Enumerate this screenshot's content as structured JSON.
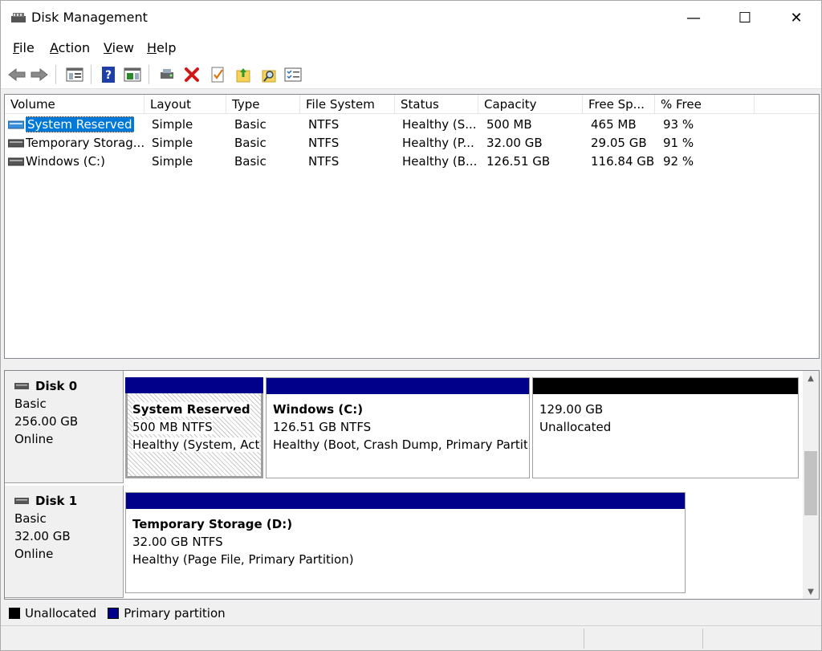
{
  "window": {
    "title": "Disk Management",
    "minimize_glyph": "—",
    "maximize_glyph": "☐",
    "close_glyph": "✕"
  },
  "menu": [
    {
      "label": "File",
      "mnemonic": "F"
    },
    {
      "label": "Action",
      "mnemonic": "A"
    },
    {
      "label": "View",
      "mnemonic": "V"
    },
    {
      "label": "Help",
      "mnemonic": "H"
    }
  ],
  "toolbar": {
    "icons": [
      "back-arrow-icon",
      "forward-arrow-icon",
      "show-hide-console-tree-icon",
      "help-icon",
      "show-hide-action-pane-icon",
      "connect-virtual-disk-icon",
      "delete-icon",
      "check-properties-icon",
      "open-folder-icon",
      "explore-icon",
      "list-view-icon"
    ]
  },
  "volume_list": {
    "columns": [
      "Volume",
      "Layout",
      "Type",
      "File System",
      "Status",
      "Capacity",
      "Free Sp...",
      "% Free"
    ],
    "rows": [
      {
        "volume": "System Reserved",
        "layout": "Simple",
        "type": "Basic",
        "fs": "NTFS",
        "status": "Healthy (S...",
        "capacity": "500 MB",
        "free": "465 MB",
        "pct": "93 %",
        "selected": true
      },
      {
        "volume": "Temporary Storag...",
        "layout": "Simple",
        "type": "Basic",
        "fs": "NTFS",
        "status": "Healthy (P...",
        "capacity": "32.00 GB",
        "free": "29.05 GB",
        "pct": "91 %",
        "selected": false
      },
      {
        "volume": "Windows (C:)",
        "layout": "Simple",
        "type": "Basic",
        "fs": "NTFS",
        "status": "Healthy (B...",
        "capacity": "126.51 GB",
        "free": "116.84 GB",
        "pct": "92 %",
        "selected": false
      }
    ]
  },
  "disks": [
    {
      "name": "Disk 0",
      "type": "Basic",
      "size": "256.00 GB",
      "state": "Online",
      "partitions": [
        {
          "title": "System Reserved",
          "line2": "500 MB NTFS",
          "line3": "Healthy (System, Acti"
        },
        {
          "title": "Windows  (C:)",
          "line2": "126.51 GB NTFS",
          "line3": "Healthy (Boot, Crash Dump, Primary Partitio"
        },
        {
          "title": "",
          "line2": "129.00 GB",
          "line3": "Unallocated"
        }
      ]
    },
    {
      "name": "Disk 1",
      "type": "Basic",
      "size": "32.00 GB",
      "state": "Online",
      "partitions": [
        {
          "title": "Temporary Storage  (D:)",
          "line2": "32.00 GB NTFS",
          "line3": "Healthy (Page File, Primary Partition)"
        }
      ]
    }
  ],
  "legend": [
    {
      "label": "Unallocated",
      "color": "#000000"
    },
    {
      "label": "Primary partition",
      "color": "#00008b"
    }
  ],
  "colors": {
    "primary": "#00008b",
    "unallocated": "#000000",
    "selection": "#0078d7"
  }
}
